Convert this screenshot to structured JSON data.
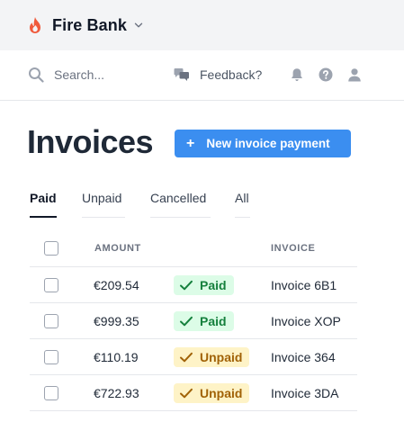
{
  "app": {
    "name": "Fire Bank",
    "brand_color": "#f05a3c"
  },
  "header": {
    "search_placeholder": "Search...",
    "feedback_label": "Feedback?",
    "icons": [
      "search-icon",
      "feedback-icon",
      "bell-icon",
      "help-icon",
      "user-icon"
    ]
  },
  "page": {
    "title": "Invoices",
    "new_button_label": "New invoice payment",
    "accent_color": "#3b8ef0"
  },
  "tabs": [
    {
      "label": "Paid",
      "active": true
    },
    {
      "label": "Unpaid",
      "active": false
    },
    {
      "label": "Cancelled",
      "active": false
    },
    {
      "label": "All",
      "active": false
    }
  ],
  "table": {
    "columns": {
      "amount": "AMOUNT",
      "invoice": "INVOICE"
    },
    "rows": [
      {
        "amount": "€209.54",
        "status": "Paid",
        "invoice": "Invoice 6B1"
      },
      {
        "amount": "€999.35",
        "status": "Paid",
        "invoice": "Invoice XOP"
      },
      {
        "amount": "€110.19",
        "status": "Unpaid",
        "invoice": "Invoice 364"
      },
      {
        "amount": "€722.93",
        "status": "Unpaid",
        "invoice": "Invoice 3DA"
      }
    ],
    "status_colors": {
      "Paid": {
        "bg": "#dcfce7",
        "fg": "#15803d"
      },
      "Unpaid": {
        "bg": "#fef3c7",
        "fg": "#a16207"
      }
    }
  }
}
